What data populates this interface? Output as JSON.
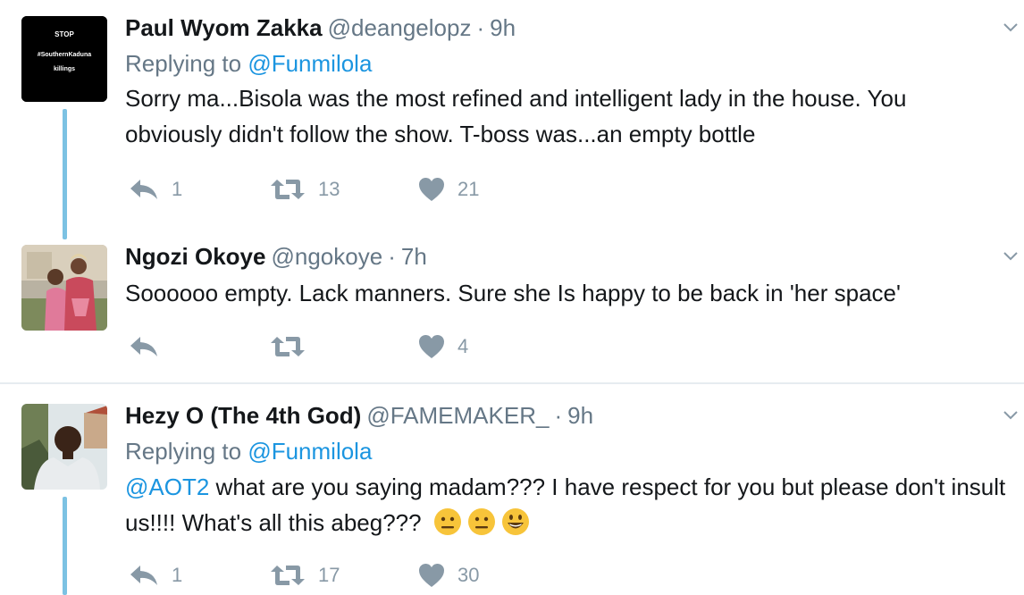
{
  "tweets": [
    {
      "name": "Paul Wyom Zakka",
      "handle": "@deangelopz",
      "time": "9h",
      "replying_label": "Replying to",
      "replying_to": "@Funmilola",
      "text": "Sorry ma...Bisola was the most refined and intelligent lady in the house. You obviously didn't follow the show. T-boss was...an empty bottle",
      "avatar_lines": [
        "STOP",
        "#SouthernKaduna",
        "killings"
      ],
      "reply_count": "1",
      "retweet_count": "13",
      "like_count": "21"
    },
    {
      "name": "Ngozi Okoye",
      "handle": "@ngokoye",
      "time": "7h",
      "text": "Soooooo empty. Lack manners. Sure she Is happy to be back in 'her space'",
      "reply_count": "",
      "retweet_count": "",
      "like_count": "4"
    },
    {
      "name": "Hezy O (The 4th God)",
      "handle": "@FAMEMAKER_",
      "time": "9h",
      "replying_label": "Replying to",
      "replying_to": "@Funmilola",
      "mention": "@AOT2",
      "text": " what are you saying madam??? I have respect for you but please don't insult us!!!! What's all this abeg???",
      "emojis": [
        "neutral-face",
        "neutral-face",
        "grinning-face"
      ],
      "reply_count": "1",
      "retweet_count": "17",
      "like_count": "30"
    }
  ],
  "colors": {
    "link": "#1b95e0",
    "muted": "#657786",
    "action": "#8899a6",
    "thread_line": "#7cc2e3"
  },
  "icons": [
    "reply-icon",
    "retweet-icon",
    "like-icon",
    "caret-down-icon"
  ]
}
